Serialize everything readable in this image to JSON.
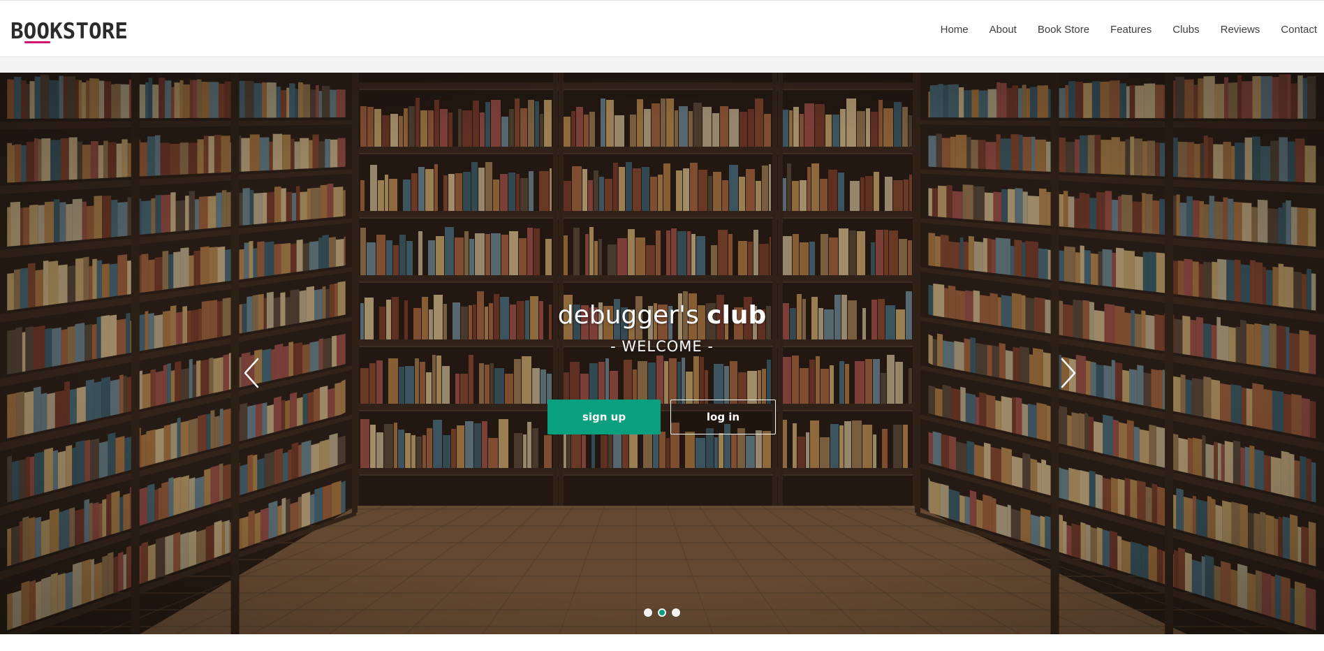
{
  "brand": {
    "logo_text": "BOOKSTORE",
    "accent_color": "#d3156f"
  },
  "nav": {
    "items": [
      "Home",
      "About",
      "Book Store",
      "Features",
      "Clubs",
      "Reviews",
      "Contact"
    ]
  },
  "hero": {
    "title_regular": "debugger's",
    "title_bold": "club",
    "subtitle": "- WELCOME -",
    "signup_label": "sign up",
    "login_label": "log in",
    "button_color": "#0aa07f",
    "prev_icon": "chevron-left-icon",
    "next_icon": "chevron-right-icon",
    "slides_total": 3,
    "active_slide": 2
  }
}
